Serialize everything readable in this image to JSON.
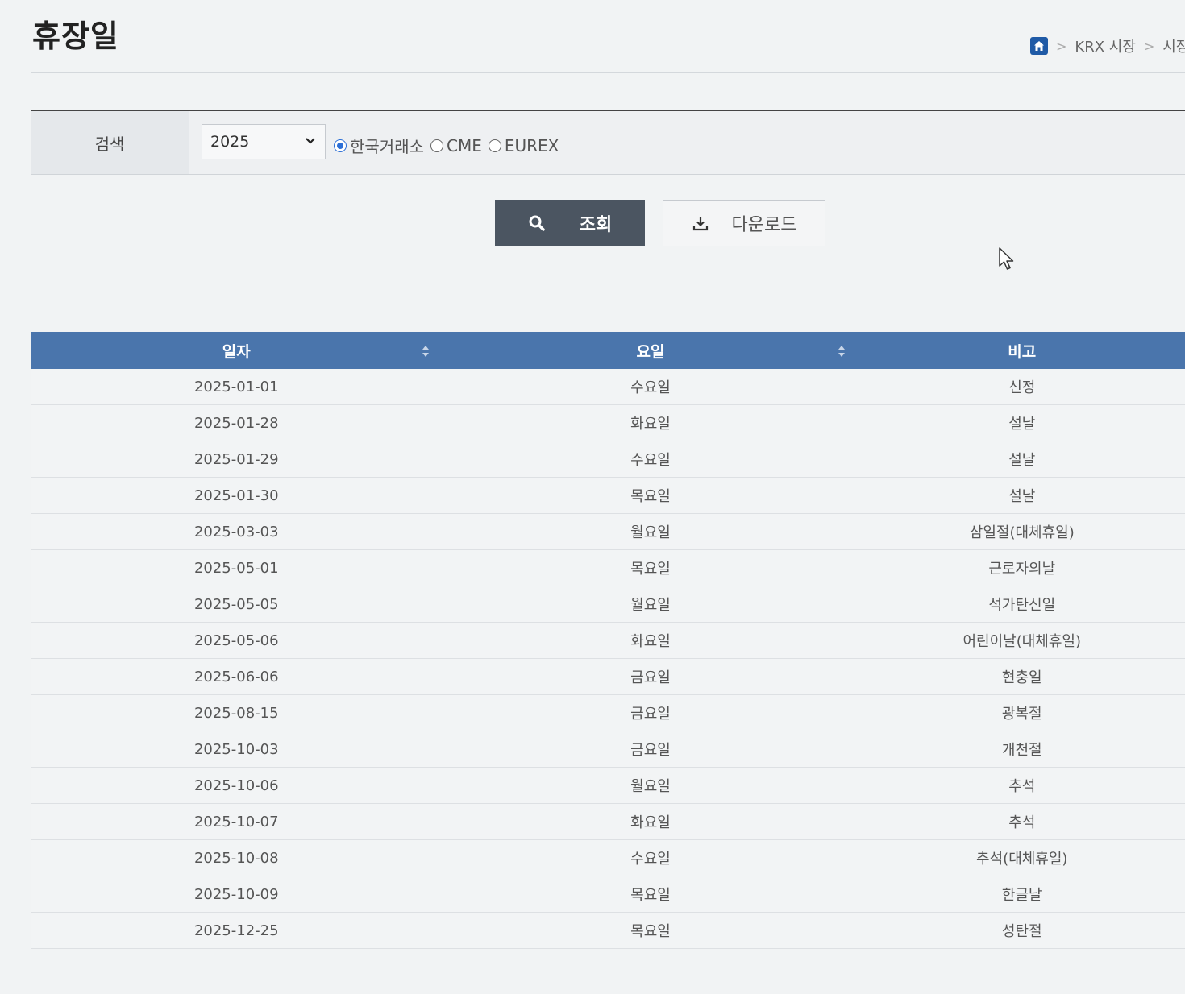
{
  "page": {
    "title": "휴장일",
    "breadcrumb": [
      "KRX 시장",
      "시장"
    ]
  },
  "search": {
    "label": "검색",
    "year": "2025",
    "options": [
      {
        "label": "한국거래소",
        "checked": true
      },
      {
        "label": "CME",
        "checked": false
      },
      {
        "label": "EUREX",
        "checked": false
      }
    ],
    "search_button": "조회",
    "download_button": "다운로드"
  },
  "table": {
    "headers": [
      "일자",
      "요일",
      "비고"
    ],
    "rows": [
      [
        "2025-01-01",
        "수요일",
        "신정"
      ],
      [
        "2025-01-28",
        "화요일",
        "설날"
      ],
      [
        "2025-01-29",
        "수요일",
        "설날"
      ],
      [
        "2025-01-30",
        "목요일",
        "설날"
      ],
      [
        "2025-03-03",
        "월요일",
        "삼일절(대체휴일)"
      ],
      [
        "2025-05-01",
        "목요일",
        "근로자의날"
      ],
      [
        "2025-05-05",
        "월요일",
        "석가탄신일"
      ],
      [
        "2025-05-06",
        "화요일",
        "어린이날(대체휴일)"
      ],
      [
        "2025-06-06",
        "금요일",
        "현충일"
      ],
      [
        "2025-08-15",
        "금요일",
        "광복절"
      ],
      [
        "2025-10-03",
        "금요일",
        "개천절"
      ],
      [
        "2025-10-06",
        "월요일",
        "추석"
      ],
      [
        "2025-10-07",
        "화요일",
        "추석"
      ],
      [
        "2025-10-08",
        "수요일",
        "추석(대체휴일)"
      ],
      [
        "2025-10-09",
        "목요일",
        "한글날"
      ],
      [
        "2025-12-25",
        "목요일",
        "성탄절"
      ]
    ]
  },
  "colors": {
    "header_bg": "#4a75ac",
    "search_button_bg": "#4b5561",
    "radio_accent": "#2c6fd6"
  }
}
